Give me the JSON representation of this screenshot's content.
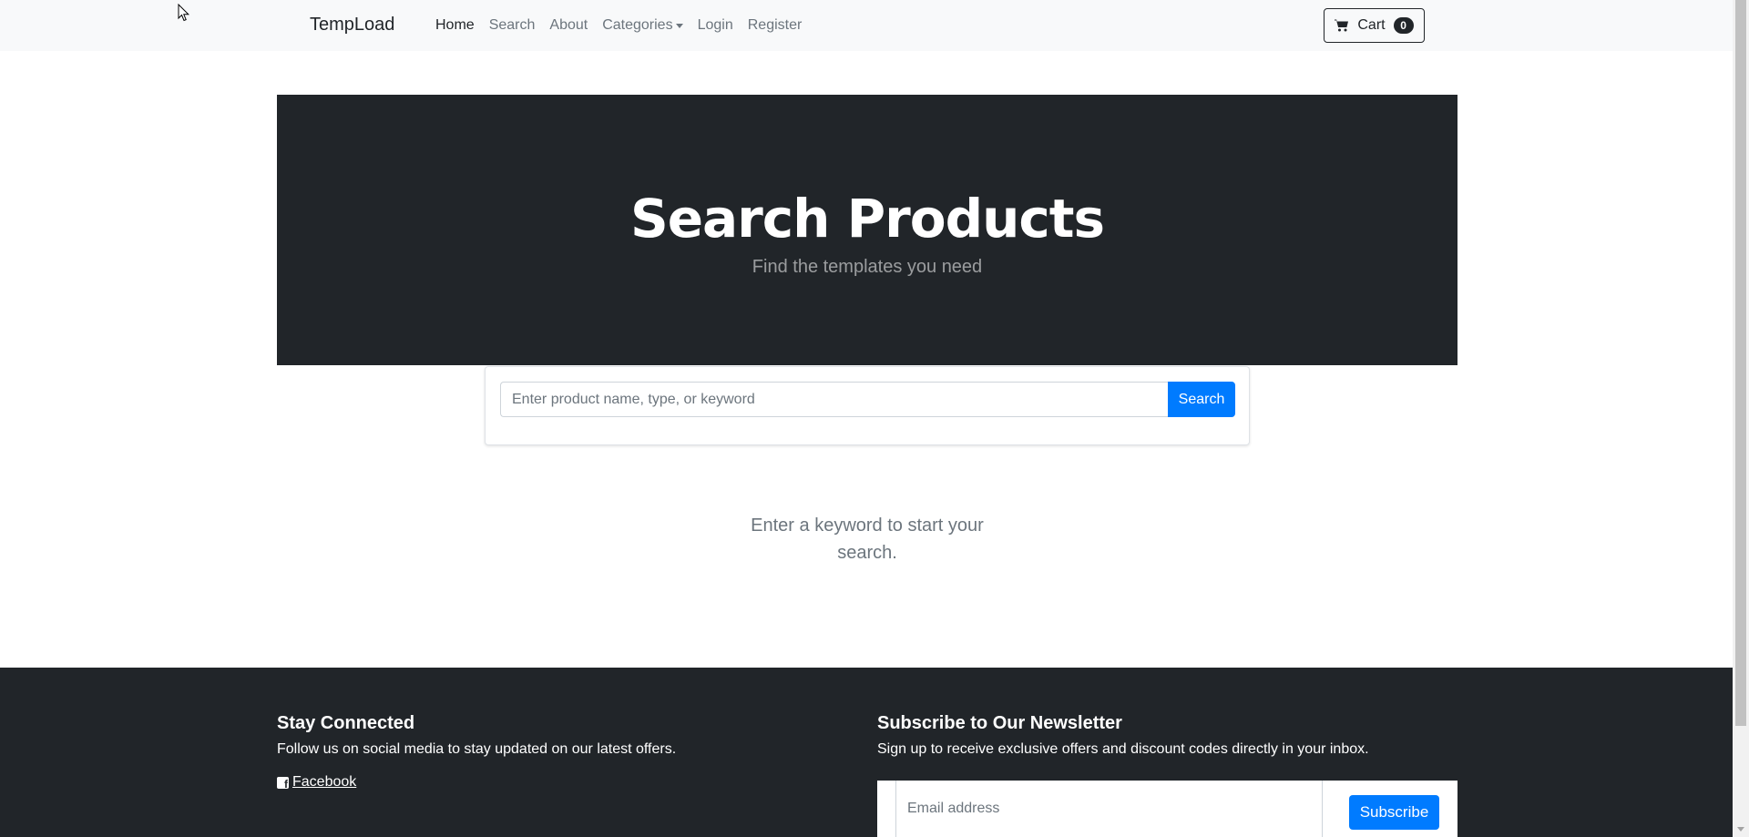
{
  "navbar": {
    "brand": "TempLoad",
    "items": [
      {
        "label": "Home",
        "active": true
      },
      {
        "label": "Search",
        "active": false
      },
      {
        "label": "About",
        "active": false
      },
      {
        "label": "Categories",
        "active": false,
        "dropdown": true
      },
      {
        "label": "Login",
        "active": false
      },
      {
        "label": "Register",
        "active": false
      }
    ],
    "cart": {
      "label": "Cart",
      "count": "0",
      "icon": "cart-icon"
    }
  },
  "hero": {
    "title": "Search Products",
    "subtitle": "Find the templates you need"
  },
  "search": {
    "placeholder": "Enter product name, type, or keyword",
    "value": "",
    "button_label": "Search"
  },
  "empty_message": "Enter a keyword to start your search.",
  "footer": {
    "left": {
      "heading": "Stay Connected",
      "text": "Follow us on social media to stay updated on our latest offers.",
      "link": "Facebook",
      "link_icon": "facebook-icon"
    },
    "right": {
      "heading": "Subscribe to Our Newsletter",
      "text": "Sign up to receive exclusive offers and discount codes directly in your inbox.",
      "email_placeholder": "Email address",
      "button_label": "Subscribe"
    }
  },
  "colors": {
    "primary": "#007bff",
    "dark": "#212529",
    "navbar_bg": "#f8f9fa",
    "muted": "#6c757d"
  }
}
